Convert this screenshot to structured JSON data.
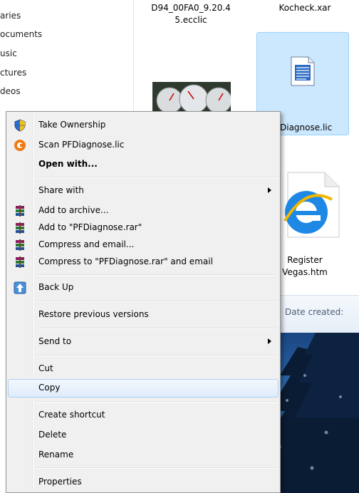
{
  "nav": {
    "items": [
      "aries",
      "ocuments",
      "usic",
      "ctures",
      "deos"
    ]
  },
  "files": {
    "file1_name_line1": "D94_00FA0_9.20.4",
    "file1_name_line2": "5.ecclic",
    "file2_name": "Kocheck.xar",
    "selected_file_name": "Diagnose.lic",
    "register_line1": "Register",
    "register_line2": "Vegas.htm",
    "date_created_label": "Date created:"
  },
  "menu": {
    "take_ownership": "Take Ownership",
    "scan": "Scan PFDiagnose.lic",
    "open_with": "Open with...",
    "share_with": "Share with",
    "add_to_archive": "Add to archive...",
    "add_to_rar": "Add to \"PFDiagnose.rar\"",
    "compress_email": "Compress and email...",
    "compress_rar_email": "Compress to \"PFDiagnose.rar\" and email",
    "back_up": "Back Up",
    "restore": "Restore previous versions",
    "send_to": "Send to",
    "cut": "Cut",
    "copy": "Copy",
    "create_shortcut": "Create shortcut",
    "delete": "Delete",
    "rename": "Rename",
    "properties": "Properties"
  },
  "icons": {
    "take_ownership": "uac-shield-icon",
    "scan": "antivirus-icon",
    "archive": "winrar-icon",
    "back_up": "backup-icon"
  },
  "colors": {
    "menu_bg": "#f0f0f0",
    "selection": "#cce8ff",
    "hover_border": "#aecff7"
  }
}
